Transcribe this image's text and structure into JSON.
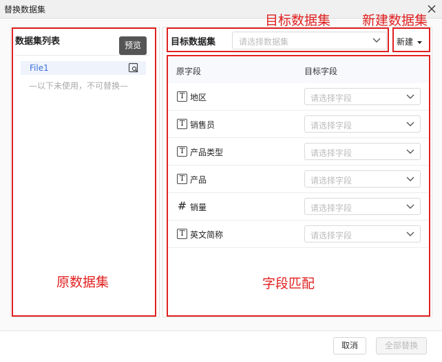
{
  "window": {
    "title": "替换数据集"
  },
  "left_panel": {
    "title": "数据集列表",
    "tooltip": "预览",
    "items": [
      {
        "label": "File1"
      }
    ],
    "note": "—以下未使用，不可替换—"
  },
  "target": {
    "label": "目标数据集",
    "placeholder": "请选择数据集",
    "new_label": "新建"
  },
  "mapping": {
    "headers": {
      "source": "原字段",
      "target": "目标字段"
    },
    "rows": [
      {
        "type": "text",
        "type_glyph": "T",
        "name": "地区",
        "placeholder": "请选择字段"
      },
      {
        "type": "text",
        "type_glyph": "T",
        "name": "销售员",
        "placeholder": "请选择字段"
      },
      {
        "type": "text",
        "type_glyph": "T",
        "name": "产品类型",
        "placeholder": "请选择字段"
      },
      {
        "type": "text",
        "type_glyph": "T",
        "name": "产品",
        "placeholder": "请选择字段"
      },
      {
        "type": "number",
        "type_glyph": "#",
        "name": "销量",
        "placeholder": "请选择字段"
      },
      {
        "type": "text",
        "type_glyph": "T",
        "name": "英文简称",
        "placeholder": "请选择字段"
      }
    ]
  },
  "annotations": {
    "target_dataset": "目标数据集",
    "new_dataset": "新建数据集",
    "source_dataset": "原数据集",
    "field_matching": "字段匹配"
  },
  "footer": {
    "cancel": "取消",
    "replace_all": "全部替换"
  },
  "colors": {
    "annotation_red": "#e02020",
    "selected_blue": "#3a6fd8",
    "selected_bg": "#eef3fc"
  }
}
